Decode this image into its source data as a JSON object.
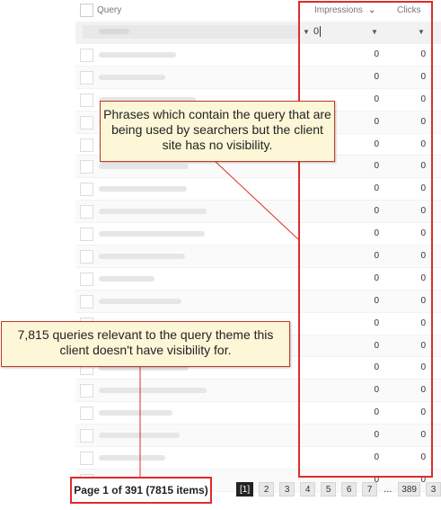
{
  "grid": {
    "headers": {
      "query": "Query",
      "impressions": "Impressions",
      "clicks": "Clicks"
    },
    "filter": {
      "impressions_value": "0"
    },
    "rows": [
      {
        "impressions": "0",
        "clicks": "0"
      },
      {
        "impressions": "0",
        "clicks": "0"
      },
      {
        "impressions": "0",
        "clicks": "0"
      },
      {
        "impressions": "0",
        "clicks": "0"
      },
      {
        "impressions": "0",
        "clicks": "0"
      },
      {
        "impressions": "0",
        "clicks": "0"
      },
      {
        "impressions": "0",
        "clicks": "0"
      },
      {
        "impressions": "0",
        "clicks": "0"
      },
      {
        "impressions": "0",
        "clicks": "0"
      },
      {
        "impressions": "0",
        "clicks": "0"
      },
      {
        "impressions": "0",
        "clicks": "0"
      },
      {
        "impressions": "0",
        "clicks": "0"
      },
      {
        "impressions": "0",
        "clicks": "0"
      },
      {
        "impressions": "0",
        "clicks": "0"
      },
      {
        "impressions": "0",
        "clicks": "0"
      },
      {
        "impressions": "0",
        "clicks": "0"
      },
      {
        "impressions": "0",
        "clicks": "0"
      },
      {
        "impressions": "0",
        "clicks": "0"
      },
      {
        "impressions": "0",
        "clicks": "0"
      },
      {
        "impressions": "0",
        "clicks": "0"
      }
    ]
  },
  "annotations": {
    "callout_top": "Phrases which contain the query that are being used by searchers but the client site has no visibility.",
    "callout_bottom": "7,815 queries relevant to the query theme this client doesn't have visibility for."
  },
  "footer": {
    "page_info": "Page 1 of 391 (7815 items)",
    "pages": [
      "[1]",
      "2",
      "3",
      "4",
      "5",
      "6",
      "7",
      "...",
      "389",
      "3"
    ]
  },
  "colors": {
    "annotation_red": "#e12b2b",
    "callout_bg": "#fdf6d7",
    "current_page_bg": "#222222"
  }
}
